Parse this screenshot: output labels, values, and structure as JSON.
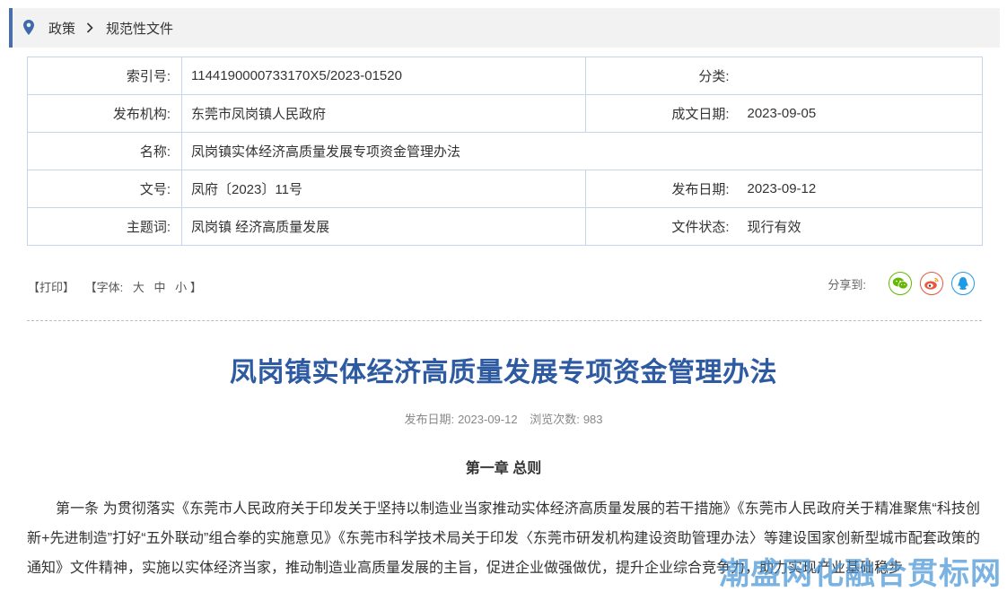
{
  "breadcrumb": {
    "home": "政策",
    "current": "规范性文件"
  },
  "meta": {
    "index_label": "索引号:",
    "index_value": "1144190000733170X5/2023-01520",
    "category_label": "分类:",
    "category_value": "",
    "issuer_label": "发布机构:",
    "issuer_value": "东莞市凤岗镇人民政府",
    "created_label": "成文日期:",
    "created_value": "2023-09-05",
    "name_label": "名称:",
    "name_value": "凤岗镇实体经济高质量发展专项资金管理办法",
    "docno_label": "文号:",
    "docno_value": "凤府〔2023〕11号",
    "published_label": "发布日期:",
    "published_value": "2023-09-12",
    "keywords_label": "主题词:",
    "keywords_value": "凤岗镇 经济高质量发展",
    "status_label": "文件状态:",
    "status_value": "现行有效"
  },
  "tools": {
    "print": "【打印】",
    "font_prefix": "【字体:",
    "font_large": "大",
    "font_medium": "中",
    "font_small": "小",
    "font_suffix": "】",
    "share_label": "分享到:"
  },
  "share_icons": [
    "wechat-icon",
    "weibo-icon",
    "qq-icon"
  ],
  "colors": {
    "accent": "#2d5aa0",
    "table_border": "#c5d6ea",
    "wechat": "#62b900",
    "weibo": "#e8573e",
    "qq": "#1f9be6"
  },
  "article": {
    "title": "凤岗镇实体经济高质量发展专项资金管理办法",
    "date_label": "发布日期:",
    "date_value": "2023-09-12",
    "views_label": "浏览次数:",
    "views_value": "983",
    "chapter": "第一章 总则",
    "paragraph": "第一条 为贯彻落实《东莞市人民政府关于印发关于坚持以制造业当家推动实体经济高质量发展的若干措施》《东莞市人民政府关于精准聚焦“科技创新+先进制造”打好“五外联动”组合拳的实施意见》《东莞市科学技术局关于印发〈东莞市研发机构建设资助管理办法〉等建设国家创新型城市配套政策的通知》文件精神，实施以实体经济当家，推动制造业高质量发展的主旨，促进企业做强做优，提升企业综合竞争力，助力实现产业基础稳步"
  },
  "watermark": "潮盛网化融合贯标网"
}
